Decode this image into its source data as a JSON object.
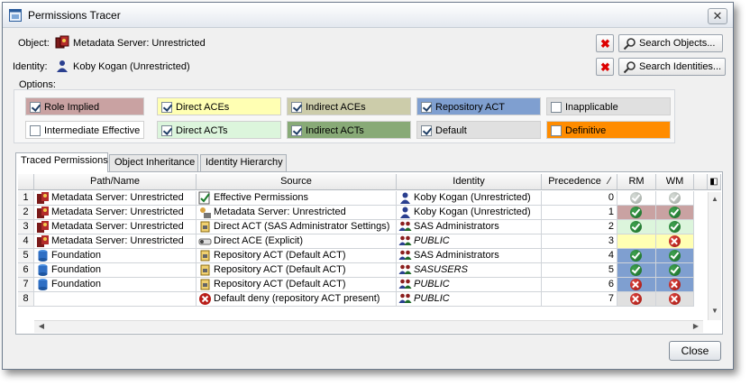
{
  "window": {
    "title": "Permissions Tracer",
    "close_glyph": "✕"
  },
  "object": {
    "label": "Object:",
    "value": "Metadata Server: Unrestricted",
    "clear_glyph": "✖",
    "search_label": "Search Objects..."
  },
  "identity": {
    "label": "Identity:",
    "value": "Koby Kogan (Unrestricted)",
    "clear_glyph": "✖",
    "search_label": "Search Identities..."
  },
  "options": {
    "label": "Options:",
    "items": [
      {
        "label": "Role Implied",
        "checked": true,
        "color": "#c9a2a2"
      },
      {
        "label": "Direct ACEs",
        "checked": true,
        "color": "#ffffb3"
      },
      {
        "label": "Indirect ACEs",
        "checked": true,
        "color": "#ccccaa"
      },
      {
        "label": "Repository ACT",
        "checked": true,
        "color": "#7f9fd0"
      },
      {
        "label": "Inapplicable",
        "checked": false,
        "color": "#e0e0e0"
      },
      {
        "label": "Intermediate Effective",
        "checked": false,
        "color": "#ffffff"
      },
      {
        "label": "Direct ACTs",
        "checked": true,
        "color": "#dcf5dc"
      },
      {
        "label": "Indirect ACTs",
        "checked": true,
        "color": "#88aa77"
      },
      {
        "label": "Default",
        "checked": true,
        "color": "#e0e0e0"
      },
      {
        "label": "Definitive",
        "checked": false,
        "color": "#ff8c00"
      }
    ]
  },
  "tabs": [
    {
      "label": "Traced Permissions",
      "active": true
    },
    {
      "label": "Object Inheritance",
      "active": false
    },
    {
      "label": "Identity Hierarchy",
      "active": false
    }
  ],
  "table": {
    "headers": {
      "path": "Path/Name",
      "source": "Source",
      "identity": "Identity",
      "precedence": "Precedence",
      "sort_glyph": "∕",
      "rm": "RM",
      "wm": "WM",
      "corner_glyph": "◧"
    },
    "rows": [
      {
        "num": "1",
        "path": "Metadata Server: Unrestricted",
        "path_icon": "server-icon",
        "source": "Effective Permissions",
        "source_icon": "effective-permissions-icon",
        "identity": "Koby Kogan (Unrestricted)",
        "identity_icon": "user-icon",
        "identity_italic": false,
        "precedence": "0",
        "rm": "grant-inherited",
        "wm": "grant-inherited",
        "rm_bg": "#ffffff",
        "wm_bg": "#ffffff"
      },
      {
        "num": "2",
        "path": "Metadata Server: Unrestricted",
        "path_icon": "server-icon",
        "source": "Metadata Server: Unrestricted",
        "source_icon": "role-icon",
        "identity": "Koby Kogan (Unrestricted)",
        "identity_icon": "user-icon",
        "identity_italic": false,
        "precedence": "1",
        "rm": "grant",
        "wm": "grant",
        "rm_bg": "#c9a2a2",
        "wm_bg": "#c9a2a2"
      },
      {
        "num": "3",
        "path": "Metadata Server: Unrestricted",
        "path_icon": "server-icon",
        "source": "Direct ACT (SAS Administrator Settings)",
        "source_icon": "act-icon",
        "identity": "SAS Administrators",
        "identity_icon": "group-icon",
        "identity_italic": false,
        "precedence": "2",
        "rm": "grant",
        "wm": "grant",
        "rm_bg": "#dcf5dc",
        "wm_bg": "#dcf5dc"
      },
      {
        "num": "4",
        "path": "Metadata Server: Unrestricted",
        "path_icon": "server-icon",
        "source": "Direct ACE (Explicit)",
        "source_icon": "ace-icon",
        "identity": "PUBLIC",
        "identity_icon": "group-icon",
        "identity_italic": true,
        "precedence": "3",
        "rm": "",
        "wm": "deny",
        "rm_bg": "#ffffb3",
        "wm_bg": "#ffffb3"
      },
      {
        "num": "5",
        "path": "Foundation",
        "path_icon": "repository-icon",
        "source": "Repository ACT (Default ACT)",
        "source_icon": "act-icon",
        "identity": "SAS Administrators",
        "identity_icon": "group-icon",
        "identity_italic": false,
        "precedence": "4",
        "rm": "grant",
        "wm": "grant",
        "rm_bg": "#7f9fd0",
        "wm_bg": "#7f9fd0"
      },
      {
        "num": "6",
        "path": "Foundation",
        "path_icon": "repository-icon",
        "source": "Repository ACT (Default ACT)",
        "source_icon": "act-icon",
        "identity": "SASUSERS",
        "identity_icon": "group-icon",
        "identity_italic": true,
        "precedence": "5",
        "rm": "grant",
        "wm": "grant",
        "rm_bg": "#7f9fd0",
        "wm_bg": "#7f9fd0"
      },
      {
        "num": "7",
        "path": "Foundation",
        "path_icon": "repository-icon",
        "source": "Repository ACT (Default ACT)",
        "source_icon": "act-icon",
        "identity": "PUBLIC",
        "identity_icon": "group-icon",
        "identity_italic": true,
        "precedence": "6",
        "rm": "deny",
        "wm": "deny",
        "rm_bg": "#7f9fd0",
        "wm_bg": "#7f9fd0"
      },
      {
        "num": "8",
        "path": "",
        "path_icon": "",
        "source": "Default deny (repository ACT present)",
        "source_icon": "deny-icon",
        "identity": "PUBLIC",
        "identity_icon": "group-icon",
        "identity_italic": true,
        "precedence": "7",
        "rm": "deny",
        "wm": "deny",
        "rm_bg": "#e0e0e0",
        "wm_bg": "#e0e0e0"
      }
    ]
  },
  "footer": {
    "close_label": "Close"
  },
  "scroll": {
    "left": "◀",
    "right": "▶",
    "up": "▲",
    "down": "▼"
  }
}
